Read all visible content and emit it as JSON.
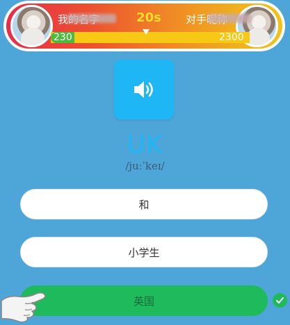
{
  "header": {
    "player_left_name": "我的名字",
    "player_right_name": "对手昵称",
    "timer": "20s",
    "score_left": "230",
    "score_right": "2300",
    "progress_left_fraction": 0.12
  },
  "question": {
    "word": "UK",
    "phonetic": "/juːˈkeɪ/",
    "audio_icon": "speaker-icon"
  },
  "options": [
    {
      "label": "和"
    },
    {
      "label": "小学生"
    },
    {
      "label": "英国"
    }
  ],
  "result": {
    "correct_index": 2,
    "correct_icon": "check-icon"
  },
  "colors": {
    "background": "#4ea6d8",
    "accent_blue": "#1eb6f5",
    "correct_green": "#1eba5b",
    "timer_yellow": "#f4dc28",
    "progress_green": "#4cba3a",
    "progress_yellow": "#f7c814"
  }
}
